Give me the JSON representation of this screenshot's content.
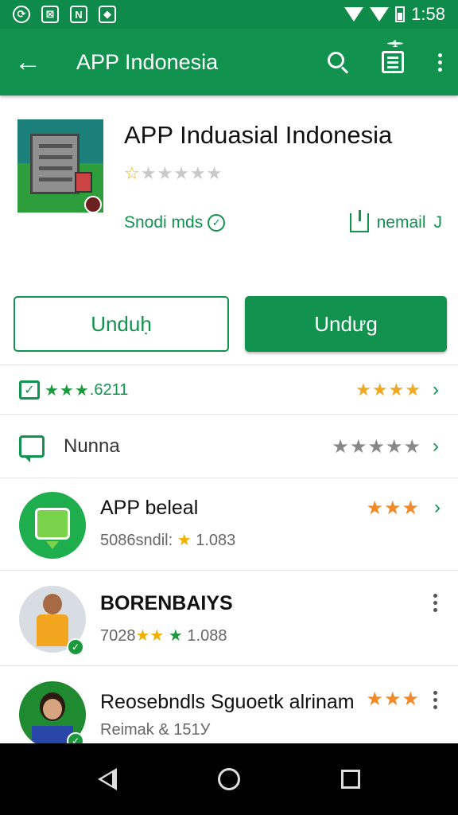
{
  "status_bar": {
    "time": "1:58"
  },
  "app_bar": {
    "title": "APP Indonesia",
    "badge_count": "1"
  },
  "app": {
    "title": "APP Induasial Indonesia",
    "rating_stars": "★★★★★",
    "developer": "Snodi mds",
    "install_label": "nemail"
  },
  "buttons": {
    "outline_label": "Unduḥ",
    "solid_label": "Undưg"
  },
  "rating_row": {
    "stars_left": "★★★",
    "count": ".6211",
    "stars_right": "★★★★"
  },
  "review_row": {
    "label": "Nunna",
    "stars": "★★★★★"
  },
  "list": [
    {
      "title": "APP beleal",
      "sub_prefix": "5086sndil:",
      "sub_star": "★",
      "sub_value": "1.083",
      "stars": "★★★",
      "trailing": "chevron"
    },
    {
      "title": "BORENBAIYS",
      "sub_prefix": "7028",
      "sub_star": "★★",
      "sub_value": "1.088",
      "trailing": "more"
    },
    {
      "title": "Reosebndls Sguoetk alrinam",
      "sub_prefix": "Reimak",
      "sub_value": "& 151У",
      "stars": "★★★",
      "trailing": "more"
    }
  ],
  "colors": {
    "primary": "#12924f",
    "status": "#0e8a4a",
    "star_gold": "#f0b000",
    "star_orange": "#f08a28",
    "badge": "#f3a518"
  },
  "icons": [
    "back-arrow-icon",
    "search-icon",
    "list-icon",
    "more-vert-icon",
    "check-circle-icon",
    "download-icon",
    "checkbox-icon",
    "message-icon",
    "chevron-right-icon",
    "nav-back-icon",
    "nav-home-icon",
    "nav-recent-icon"
  ]
}
